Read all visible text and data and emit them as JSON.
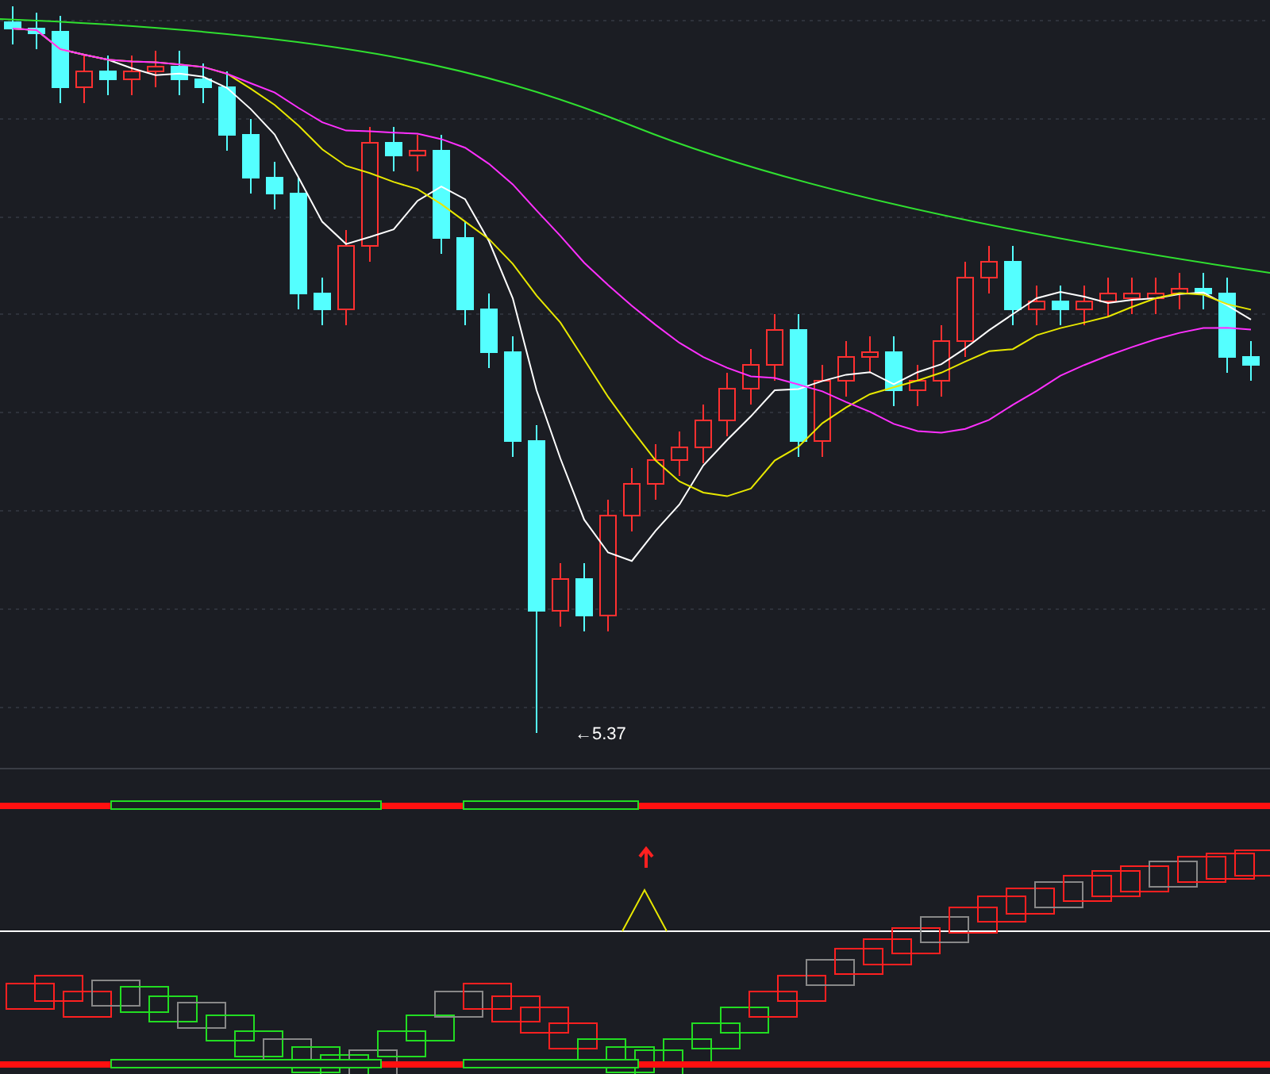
{
  "price_chart": {
    "low_price_label": "←5.37"
  }
}
